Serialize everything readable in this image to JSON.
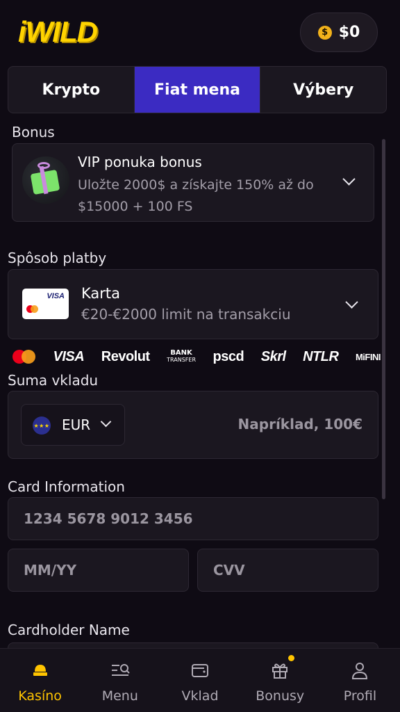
{
  "header": {
    "logo": "iWILD",
    "balance": "$0",
    "coin_symbol": "$"
  },
  "tabs": [
    {
      "label": "Krypto",
      "active": false
    },
    {
      "label": "Fiat mena",
      "active": true
    },
    {
      "label": "Výbery",
      "active": false
    }
  ],
  "bonus": {
    "section_label": "Bonus",
    "title": "VIP ponuka bonus",
    "description": "Uložte 2000$ a získajte 150% až do $15000 + 100 FS"
  },
  "payment": {
    "section_label": "Spôsob platby",
    "method": "Karta",
    "limit": "€20-€2000 limit na transakciu",
    "card_brand": "VISA",
    "logos": [
      "VISA",
      "Revolut",
      "BANK",
      "TRANSFER",
      "pscd",
      "Skrl",
      "NTLR",
      "MiFINI"
    ]
  },
  "deposit": {
    "section_label": "Suma vkladu",
    "currency": "EUR",
    "amount_placeholder": "Napríklad, 100€"
  },
  "card_info": {
    "section_label": "Card Information",
    "number_placeholder": "1234 5678 9012 3456",
    "expiry_placeholder": "MM/YY",
    "cvv_placeholder": "CVV"
  },
  "cardholder": {
    "section_label": "Cardholder Name"
  },
  "nav": [
    {
      "label": "Kasíno",
      "icon": "casino-icon",
      "active": true
    },
    {
      "label": "Menu",
      "icon": "menu-search-icon",
      "active": false
    },
    {
      "label": "Vklad",
      "icon": "wallet-icon",
      "active": false
    },
    {
      "label": "Bonusy",
      "icon": "gift-icon",
      "active": false,
      "badge": true
    },
    {
      "label": "Profil",
      "icon": "user-icon",
      "active": false
    }
  ],
  "colors": {
    "accent": "#3b2bc2",
    "brand_yellow": "#ffd400",
    "background": "#0f0b14",
    "panel": "#1b1720"
  }
}
